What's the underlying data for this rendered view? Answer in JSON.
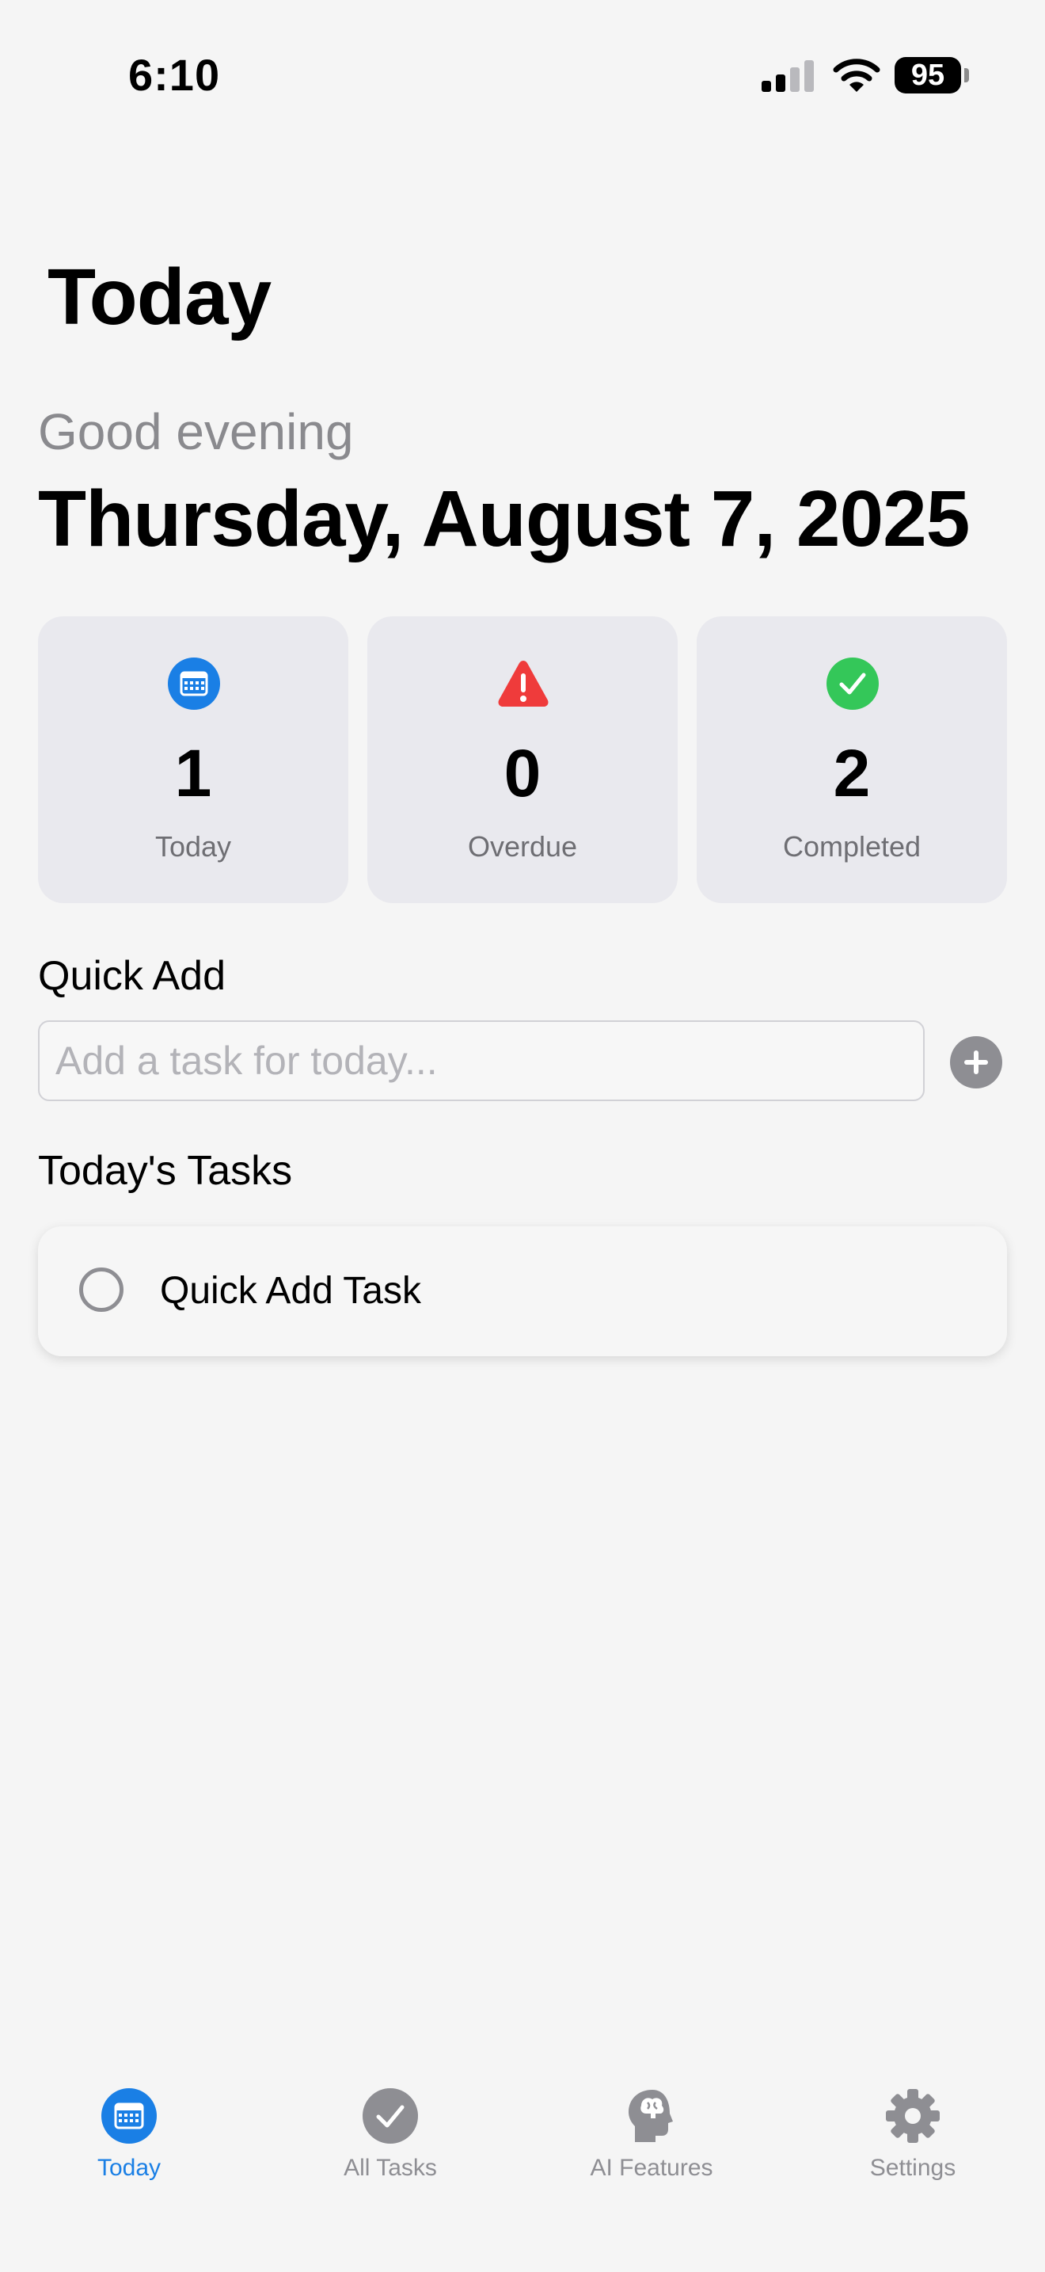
{
  "status_bar": {
    "time": "6:10",
    "battery": "95"
  },
  "page_title": "Today",
  "greeting": "Good evening",
  "date": "Thursday, August 7, 2025",
  "stats": [
    {
      "icon": "calendar-icon",
      "value": "1",
      "label": "Today",
      "color": "#1a7fe5"
    },
    {
      "icon": "warning-icon",
      "value": "0",
      "label": "Overdue",
      "color": "#ef3b3b"
    },
    {
      "icon": "checkmark-circle-icon",
      "value": "2",
      "label": "Completed",
      "color": "#34c759"
    }
  ],
  "quick_add": {
    "heading": "Quick Add",
    "placeholder": "Add a task for today..."
  },
  "tasks": {
    "heading": "Today's Tasks",
    "items": [
      {
        "title": "Quick Add Task",
        "completed": false
      }
    ]
  },
  "tab_bar": {
    "items": [
      {
        "icon": "calendar-icon",
        "label": "Today",
        "active": true
      },
      {
        "icon": "checkmark-circle-icon",
        "label": "All Tasks",
        "active": false
      },
      {
        "icon": "brain-head-icon",
        "label": "AI Features",
        "active": false
      },
      {
        "icon": "gear-icon",
        "label": "Settings",
        "active": false
      }
    ]
  },
  "colors": {
    "accent": "#1a7fe5",
    "danger": "#ef3b3b",
    "success": "#34c759",
    "inactive": "#8e8e93"
  }
}
